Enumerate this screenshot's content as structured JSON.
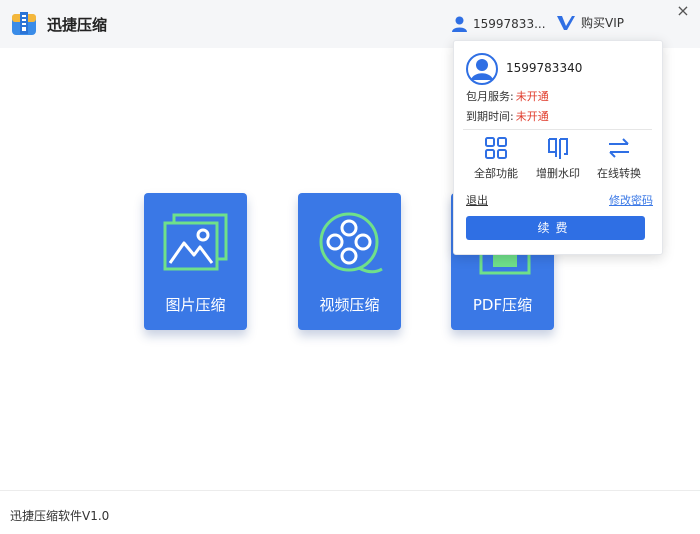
{
  "app": {
    "title": "迅捷压缩",
    "version_text": "迅捷压缩软件V1.0"
  },
  "header": {
    "username": "15997833...",
    "vip_label": "购买VIP",
    "close_glyph": "×",
    "user_icon": "user-icon",
    "vip_icon": "vip-v-icon"
  },
  "cards": {
    "image": {
      "label": "图片压缩",
      "icon": "image-icon"
    },
    "video": {
      "label": "视频压缩",
      "icon": "film-reel-icon"
    },
    "pdf": {
      "label": "PDF压缩",
      "icon": "pdf-icon"
    }
  },
  "popup": {
    "username": "1599783340",
    "monthly_label": "包月服务:",
    "monthly_value": "未开通",
    "expire_label": "到期时间:",
    "expire_value": "未开通",
    "functions": [
      {
        "label": "全部功能",
        "icon": "grid-icon"
      },
      {
        "label": "增删水印",
        "icon": "stamp-icon"
      },
      {
        "label": "在线转换",
        "icon": "convert-icon"
      }
    ],
    "logout_label": "退出",
    "change_password_label": "修改密码",
    "renew_label": "续费"
  },
  "colors": {
    "accent": "#3a78e6",
    "warning_text": "#e03c2c",
    "titlebar_bg": "#f5f6f8"
  }
}
